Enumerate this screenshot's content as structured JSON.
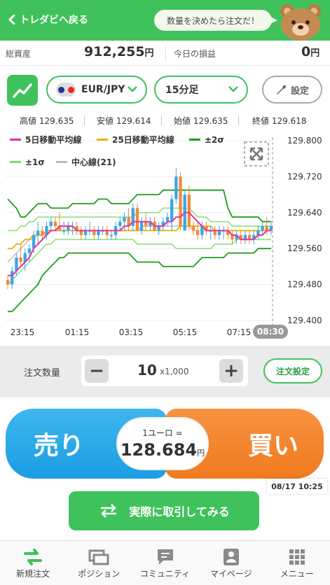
{
  "header": {
    "back_label": "トレダビへ戻る",
    "bubble_text": "数量を決めたら注文だ！"
  },
  "assets": {
    "total_label": "総資産",
    "total_value": "912,255",
    "total_unit": "円",
    "pnl_label": "今日の損益",
    "pnl_value": "0",
    "pnl_unit": "円"
  },
  "controls": {
    "pair": "EUR/JPY",
    "timeframe": "15分足",
    "settings_label": "設定"
  },
  "ohlc": {
    "high_label": "高値",
    "high": "129.635",
    "low_label": "安値",
    "low": "129.614",
    "open_label": "始値",
    "open": "129.635",
    "close_label": "終値",
    "close": "129.618"
  },
  "chart_data": {
    "type": "candlestick",
    "legend": [
      {
        "name": "5日移動平均線",
        "color": "#e0359b"
      },
      {
        "name": "25日移動平均線",
        "color": "#e6b400"
      },
      {
        "name": "±2σ",
        "color": "#1e9e1e"
      },
      {
        "name": "±1σ",
        "color": "#7ddc6e"
      },
      {
        "name": "中心線(21)",
        "color": "#bbbbbb"
      }
    ],
    "y_ticks": [
      "129.800",
      "129.720",
      "129.640",
      "129.560",
      "129.480",
      "129.400"
    ],
    "ylim": [
      129.4,
      129.8
    ],
    "x_ticks": [
      "23:15",
      "01:15",
      "03:15",
      "05:15",
      "07:15"
    ],
    "current_time": "08:30",
    "up_color": "#3aa6e8",
    "down_color": "#f18a34",
    "candles": [
      [
        129.49,
        129.5,
        129.47,
        129.48
      ],
      [
        129.48,
        129.52,
        129.47,
        129.51
      ],
      [
        129.51,
        129.55,
        129.5,
        129.54
      ],
      [
        129.54,
        129.57,
        129.52,
        129.53
      ],
      [
        129.53,
        129.56,
        129.51,
        129.55
      ],
      [
        129.55,
        129.57,
        129.53,
        129.56
      ],
      [
        129.56,
        129.6,
        129.55,
        129.59
      ],
      [
        129.59,
        129.62,
        129.57,
        129.6
      ],
      [
        129.6,
        129.61,
        129.58,
        129.59
      ],
      [
        129.59,
        129.62,
        129.58,
        129.61
      ],
      [
        129.61,
        129.63,
        129.6,
        129.62
      ],
      [
        129.62,
        129.63,
        129.6,
        129.61
      ],
      [
        129.61,
        129.64,
        129.6,
        129.6
      ],
      [
        129.6,
        129.62,
        129.59,
        129.6
      ],
      [
        129.6,
        129.62,
        129.59,
        129.61
      ],
      [
        129.61,
        129.62,
        129.59,
        129.61
      ],
      [
        129.61,
        129.62,
        129.59,
        129.6
      ],
      [
        129.6,
        129.61,
        129.58,
        129.59
      ],
      [
        129.59,
        129.61,
        129.58,
        129.6
      ],
      [
        129.6,
        129.62,
        129.59,
        129.6
      ],
      [
        129.6,
        129.61,
        129.58,
        129.59
      ],
      [
        129.59,
        129.61,
        129.58,
        129.6
      ],
      [
        129.6,
        129.61,
        129.59,
        129.6
      ],
      [
        129.6,
        129.61,
        129.58,
        129.59
      ],
      [
        129.59,
        129.6,
        129.58,
        129.59
      ],
      [
        129.59,
        129.62,
        129.58,
        129.61
      ],
      [
        129.61,
        129.63,
        129.6,
        129.62
      ],
      [
        129.62,
        129.64,
        129.6,
        129.63
      ],
      [
        129.63,
        129.65,
        129.6,
        129.61
      ],
      [
        129.61,
        129.66,
        129.6,
        129.65
      ],
      [
        129.65,
        129.66,
        129.6,
        129.6
      ],
      [
        129.6,
        129.63,
        129.59,
        129.62
      ],
      [
        129.62,
        129.64,
        129.6,
        129.61
      ],
      [
        129.61,
        129.63,
        129.6,
        129.62
      ],
      [
        129.62,
        129.63,
        129.6,
        129.6
      ],
      [
        129.6,
        129.62,
        129.59,
        129.61
      ],
      [
        129.61,
        129.63,
        129.6,
        129.62
      ],
      [
        129.62,
        129.64,
        129.61,
        129.63
      ],
      [
        129.62,
        129.68,
        129.6,
        129.67
      ],
      [
        129.67,
        129.74,
        129.66,
        129.72
      ],
      [
        129.72,
        129.73,
        129.6,
        129.61
      ],
      [
        129.6,
        129.69,
        129.6,
        129.68
      ],
      [
        129.68,
        129.7,
        129.6,
        129.61
      ],
      [
        129.61,
        129.62,
        129.59,
        129.6
      ],
      [
        129.6,
        129.62,
        129.58,
        129.59
      ],
      [
        129.59,
        129.62,
        129.58,
        129.61
      ],
      [
        129.61,
        129.62,
        129.59,
        129.6
      ],
      [
        129.6,
        129.61,
        129.58,
        129.6
      ],
      [
        129.6,
        129.61,
        129.58,
        129.59
      ],
      [
        129.59,
        129.61,
        129.58,
        129.6
      ],
      [
        129.6,
        129.61,
        129.58,
        129.6
      ],
      [
        129.6,
        129.61,
        129.58,
        129.59
      ],
      [
        129.59,
        129.6,
        129.57,
        129.58
      ],
      [
        129.58,
        129.6,
        129.57,
        129.59
      ],
      [
        129.59,
        129.6,
        129.57,
        129.58
      ],
      [
        129.58,
        129.6,
        129.57,
        129.59
      ],
      [
        129.59,
        129.6,
        129.57,
        129.58
      ],
      [
        129.58,
        129.6,
        129.57,
        129.59
      ],
      [
        129.59,
        129.61,
        129.58,
        129.6
      ],
      [
        129.6,
        129.62,
        129.59,
        129.61
      ],
      [
        129.61,
        129.63,
        129.59,
        129.6
      ],
      [
        129.6,
        129.62,
        129.59,
        129.61
      ]
    ],
    "bands": {
      "upper2": [
        129.67,
        129.66,
        129.65,
        129.63,
        129.63,
        129.64,
        129.65,
        129.66,
        129.66,
        129.66,
        129.65,
        129.65,
        129.65,
        129.65,
        129.65,
        129.66,
        129.66,
        129.66,
        129.66,
        129.66,
        129.66,
        129.67,
        129.67,
        129.67,
        129.66,
        129.66,
        129.66,
        129.66,
        129.66,
        129.67,
        129.68,
        129.68,
        129.68,
        129.68,
        129.68,
        129.68,
        129.69,
        129.69,
        129.69,
        129.69,
        129.69,
        129.69,
        129.69,
        129.69,
        129.69,
        129.69,
        129.69,
        129.69,
        129.69,
        129.69,
        129.69,
        129.65,
        129.63,
        129.63,
        129.63,
        129.63,
        129.63,
        129.63,
        129.63,
        129.62,
        129.62,
        129.62
      ],
      "upper1": [
        129.6,
        129.6,
        129.6,
        129.61,
        129.61,
        129.62,
        129.62,
        129.63,
        129.63,
        129.63,
        129.63,
        129.63,
        129.63,
        129.63,
        129.63,
        129.63,
        129.63,
        129.63,
        129.63,
        129.63,
        129.63,
        129.63,
        129.63,
        129.63,
        129.63,
        129.63,
        129.63,
        129.63,
        129.63,
        129.63,
        129.64,
        129.64,
        129.64,
        129.64,
        129.64,
        129.64,
        129.65,
        129.65,
        129.65,
        129.65,
        129.65,
        129.65,
        129.65,
        129.64,
        129.63,
        129.63,
        129.63,
        129.62,
        129.62,
        129.62,
        129.62,
        129.62,
        129.61,
        129.61,
        129.61,
        129.61,
        129.61,
        129.61,
        129.61,
        129.61,
        129.61,
        129.61
      ],
      "center": [
        129.53,
        129.54,
        129.55,
        129.56,
        129.57,
        129.58,
        129.58,
        129.59,
        129.59,
        129.59,
        129.6,
        129.6,
        129.6,
        129.6,
        129.6,
        129.6,
        129.6,
        129.6,
        129.6,
        129.6,
        129.6,
        129.6,
        129.6,
        129.6,
        129.6,
        129.6,
        129.6,
        129.6,
        129.6,
        129.6,
        129.6,
        129.61,
        129.61,
        129.61,
        129.61,
        129.61,
        129.61,
        129.61,
        129.61,
        129.61,
        129.61,
        129.61,
        129.61,
        129.6,
        129.6,
        129.6,
        129.6,
        129.6,
        129.6,
        129.6,
        129.6,
        129.6,
        129.6,
        129.6,
        129.6,
        129.6,
        129.6,
        129.6,
        129.6,
        129.6,
        129.6,
        129.6
      ],
      "lower1": [
        129.48,
        129.49,
        129.5,
        129.51,
        129.52,
        129.53,
        129.54,
        129.55,
        129.56,
        129.57,
        129.57,
        129.58,
        129.58,
        129.58,
        129.58,
        129.58,
        129.58,
        129.58,
        129.58,
        129.58,
        129.58,
        129.58,
        129.58,
        129.58,
        129.58,
        129.58,
        129.58,
        129.58,
        129.58,
        129.58,
        129.57,
        129.57,
        129.57,
        129.57,
        129.57,
        129.57,
        129.57,
        129.57,
        129.57,
        129.56,
        129.56,
        129.56,
        129.56,
        129.56,
        129.56,
        129.56,
        129.56,
        129.56,
        129.57,
        129.57,
        129.57,
        129.57,
        129.57,
        129.58,
        129.58,
        129.58,
        129.58,
        129.58,
        129.58,
        129.58,
        129.58,
        129.58
      ],
      "lower2": [
        129.42,
        129.42,
        129.43,
        129.44,
        129.45,
        129.46,
        129.47,
        129.48,
        129.5,
        129.51,
        129.52,
        129.53,
        129.54,
        129.54,
        129.55,
        129.55,
        129.55,
        129.55,
        129.55,
        129.55,
        129.55,
        129.55,
        129.55,
        129.55,
        129.55,
        129.55,
        129.55,
        129.55,
        129.55,
        129.54,
        129.53,
        129.53,
        129.53,
        129.53,
        129.53,
        129.53,
        129.52,
        129.52,
        129.52,
        129.52,
        129.52,
        129.52,
        129.52,
        129.52,
        129.53,
        129.54,
        129.54,
        129.54,
        129.54,
        129.54,
        129.54,
        129.55,
        129.55,
        129.55,
        129.55,
        129.55,
        129.55,
        129.55,
        129.56,
        129.56,
        129.56,
        129.56
      ],
      "ma5": [
        129.5,
        129.5,
        129.51,
        129.52,
        129.53,
        129.54,
        129.56,
        129.57,
        129.58,
        129.59,
        129.6,
        129.6,
        129.61,
        129.61,
        129.61,
        129.61,
        129.6,
        129.6,
        129.6,
        129.6,
        129.6,
        129.6,
        129.6,
        129.6,
        129.6,
        129.6,
        129.6,
        129.61,
        129.61,
        129.62,
        129.62,
        129.62,
        129.62,
        129.62,
        129.61,
        129.61,
        129.61,
        129.62,
        129.62,
        129.63,
        129.63,
        129.64,
        129.64,
        129.63,
        129.62,
        129.61,
        129.6,
        129.6,
        129.6,
        129.6,
        129.6,
        129.6,
        129.59,
        129.59,
        129.58,
        129.58,
        129.58,
        129.58,
        129.59,
        129.59,
        129.6,
        129.6
      ],
      "ma25": [
        129.56,
        129.56,
        129.57,
        129.57,
        129.58,
        129.58,
        129.59,
        129.59,
        129.59,
        129.6,
        129.6,
        129.6,
        129.6,
        129.6,
        129.6,
        129.6,
        129.6,
        129.6,
        129.6,
        129.6,
        129.6,
        129.6,
        129.6,
        129.6,
        129.6,
        129.6,
        129.6,
        129.6,
        129.6,
        129.6,
        129.6,
        129.6,
        129.6,
        129.6,
        129.6,
        129.6,
        129.6,
        129.6,
        129.6,
        129.6,
        129.61,
        129.61,
        129.61,
        129.61,
        129.61,
        129.61,
        129.61,
        129.61,
        129.6,
        129.6,
        129.6,
        129.6,
        129.6,
        129.6,
        129.6,
        129.6,
        129.6,
        129.6,
        129.6,
        129.6,
        129.6,
        129.6
      ]
    }
  },
  "order": {
    "qty_label": "注文数量",
    "qty_value": "10",
    "qty_unit": "x1,000",
    "minus": "−",
    "plus": "+",
    "settings_label": "注文設定"
  },
  "trade": {
    "sell_label": "売り",
    "buy_label": "買い",
    "rate_label": "1ユーロ =",
    "rate_value": "128.684",
    "rate_unit": "円",
    "datetime": "08/17 10:25",
    "real_trade_label": "実際に取引してみる"
  },
  "nav": {
    "items": [
      "新規注文",
      "ポジション",
      "コミュニティ",
      "マイページ",
      "メニュー"
    ]
  },
  "colors": {
    "brand_green": "#3fc25b",
    "sell_blue": "#1a9de3",
    "buy_orange": "#f07a1f"
  }
}
